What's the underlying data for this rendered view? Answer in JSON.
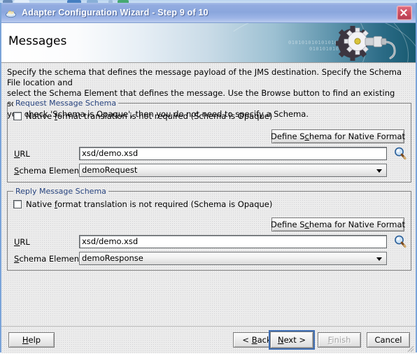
{
  "window": {
    "title": "Adapter Configuration Wizard - Step 9 of 10",
    "app_icon": "java-coffee-cup-icon",
    "close_label": "×"
  },
  "banner": {
    "heading": "Messages",
    "decor_binary_1": "01010101010101010101010101",
    "decor_binary_2": "0101010101010",
    "graphic": "gear-plug-icon"
  },
  "intro": {
    "line1": "Specify the schema that defines the message payload of the JMS destination.  Specify the Schema File location and",
    "line2": "select the Schema Element that defines the message. Use the Browse button to find an existing schema definition. If",
    "line3": "you check 'Schema is Opaque', then you do not need to specify a Schema."
  },
  "request_group": {
    "legend": "Request Message Schema",
    "opaque_checkbox": {
      "label_pre": "Native ",
      "label_mnemonic": "f",
      "label_post": "ormat translation is not required (Schema is Opaque)",
      "checked": false
    },
    "define_button": {
      "pre": "Define S",
      "mnemonic": "c",
      "post": "hema for Native Format"
    },
    "url_label": {
      "mnemonic": "U",
      "post": "RL"
    },
    "url_value": "xsd/demo.xsd",
    "browse_icon": "magnifier-icon",
    "schema_element_label": {
      "mnemonic": "S",
      "post": "chema Element"
    },
    "schema_element_value": "demoRequest"
  },
  "reply_group": {
    "legend": "Reply Message Schema",
    "opaque_checkbox": {
      "label_pre": "Native ",
      "label_mnemonic": "f",
      "label_post": "ormat translation is not required (Schema is Opaque)",
      "checked": false
    },
    "define_button": {
      "pre": "Define S",
      "mnemonic": "c",
      "post": "hema for Native Format"
    },
    "url_label": {
      "mnemonic": "U",
      "post": "RL"
    },
    "url_value": "xsd/demo.xsd",
    "browse_icon": "magnifier-icon",
    "schema_element_label": {
      "mnemonic": "S",
      "post": "chema Element"
    },
    "schema_element_value": "demoResponse"
  },
  "footer": {
    "help": {
      "mnemonic": "H",
      "post": "elp"
    },
    "back": {
      "pre": "< ",
      "mnemonic": "B",
      "post": "ack"
    },
    "next": {
      "mnemonic": "N",
      "post": "ext >",
      "focused": true
    },
    "finish": {
      "mnemonic": "F",
      "post": "inish",
      "disabled": true
    },
    "cancel": {
      "label": "Cancel"
    }
  },
  "colors": {
    "titlebar_blue": "#8aa6dd",
    "legend_blue": "#27437e",
    "banner_teal": "#17596f",
    "close_red": "#cf5061",
    "content_gray": "#ececec"
  }
}
